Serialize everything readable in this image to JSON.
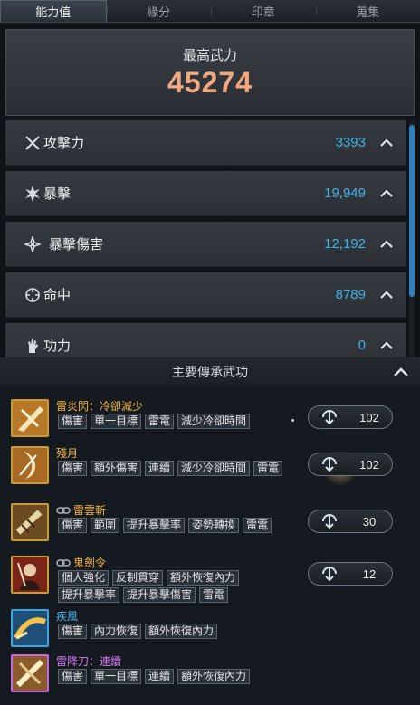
{
  "tabs": [
    {
      "label": "能力值",
      "active": true
    },
    {
      "label": "緣分",
      "active": false
    },
    {
      "label": "印章",
      "active": false
    },
    {
      "label": "蒐集",
      "active": false
    }
  ],
  "header": {
    "label": "最高武力",
    "value": "45274"
  },
  "stats": [
    {
      "icon": "crossed-swords-icon",
      "label": "攻擊力",
      "value": "3393"
    },
    {
      "icon": "burst-icon",
      "label": "暴擊",
      "value": "19,949"
    },
    {
      "icon": "shuriken-icon",
      "label": "暴擊傷害",
      "value": "12,192"
    },
    {
      "icon": "crosshair-icon",
      "label": "命中",
      "value": "8789"
    },
    {
      "icon": "power-fist-icon",
      "label": "功力",
      "value": "0"
    }
  ],
  "section": {
    "title": "主要傳承武功"
  },
  "skills": [
    {
      "name": "雷炎閃：冷卻減少",
      "color": "gold",
      "locked": false,
      "tags": [
        "傷害",
        "單一目標",
        "雷電",
        "減少冷卻時間"
      ],
      "level": "102"
    },
    {
      "name": "殘月",
      "color": "gold",
      "locked": false,
      "tags": [
        "傷害",
        "額外傷害",
        "連續",
        "減少冷卻時間",
        "雷電"
      ],
      "level": "102"
    },
    {
      "name": "雷雲斬",
      "color": "gold",
      "locked": true,
      "tags": [
        "傷害",
        "範圍",
        "提升暴擊率",
        "姿勢轉換",
        "雷電"
      ],
      "level": "30"
    },
    {
      "name": "鬼劍令",
      "color": "gold",
      "locked": true,
      "tags": [
        "個人強化",
        "反制貫穿",
        "額外恢復內力",
        "提升暴擊率",
        "提升暴擊傷害",
        "雷電"
      ],
      "level": "12"
    },
    {
      "name": "疾風",
      "color": "blue",
      "locked": false,
      "tags": [
        "傷害",
        "內力恢復",
        "額外恢復內力"
      ],
      "level": ""
    },
    {
      "name": "雷降刀：連續",
      "color": "purple",
      "locked": false,
      "tags": [
        "傷害",
        "單一目標",
        "連續",
        "額外恢復內力"
      ],
      "level": ""
    }
  ],
  "colors": {
    "accent_blue": "#3fb4e8",
    "header_value": "#f0a980",
    "gold": "#f4b53c",
    "purple": "#d27bf2"
  }
}
